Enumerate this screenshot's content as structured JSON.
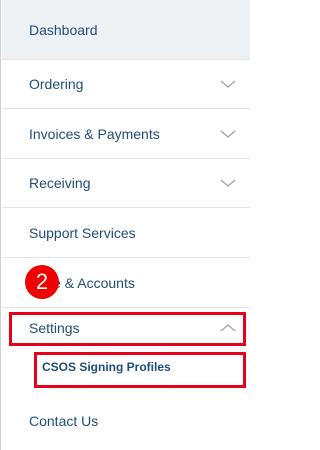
{
  "nav": {
    "dashboard": "Dashboard",
    "ordering": "Ordering",
    "invoices": "Invoices & Payments",
    "receiving": "Receiving",
    "support": "Support Services",
    "profile_accounts": "Profile & Accounts",
    "profile_accounts_visible": "le & Accounts",
    "settings": "Settings",
    "settings_sub": [
      "CSOS Signing Profiles"
    ],
    "contact": "Contact Us"
  },
  "annotation": {
    "step": "2"
  },
  "colors": {
    "link": "#1f4e79",
    "highlight": "#e6001a",
    "badge": "#ee0000"
  }
}
